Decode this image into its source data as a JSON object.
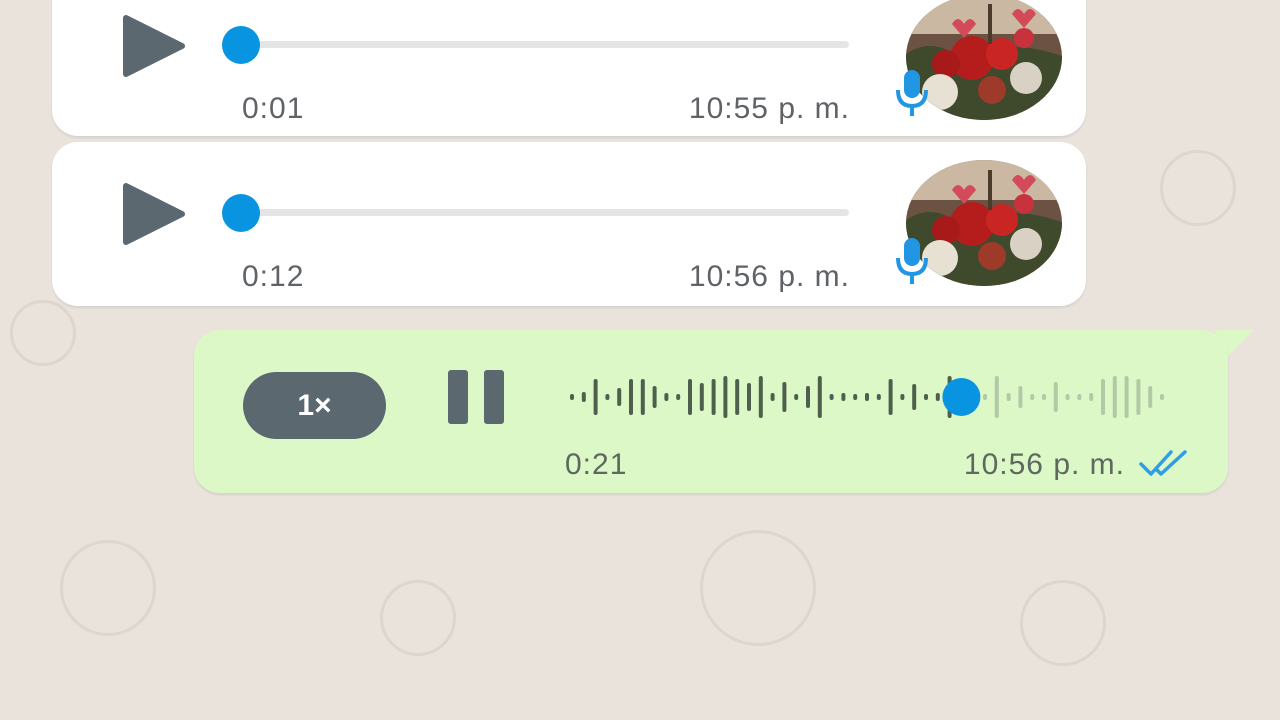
{
  "messages": [
    {
      "direction": "incoming",
      "duration": "0:01",
      "time": "10:55 p. m.",
      "progress": 0,
      "avatar_icon": "flower-bouquet-avatar",
      "badge_icon": "mic-icon"
    },
    {
      "direction": "incoming",
      "duration": "0:12",
      "time": "10:56 p. m.",
      "progress": 0,
      "avatar_icon": "flower-bouquet-avatar",
      "badge_icon": "mic-icon"
    }
  ],
  "outgoing": {
    "speed_label": "1×",
    "state": "playing",
    "duration": "0:21",
    "time": "10:56 p. m.",
    "progress": 0.66,
    "read_status_icon": "double-check-icon"
  },
  "colors": {
    "accent_blue": "#0894e0",
    "incoming_bg": "#ffffff",
    "outgoing_bg": "#dcf8c6",
    "chat_bg": "#e9e3dc",
    "speed_button_bg": "#5b6870",
    "waveform_played": "#4e5f4e",
    "waveform_unplayed": "#b3c9a6"
  }
}
